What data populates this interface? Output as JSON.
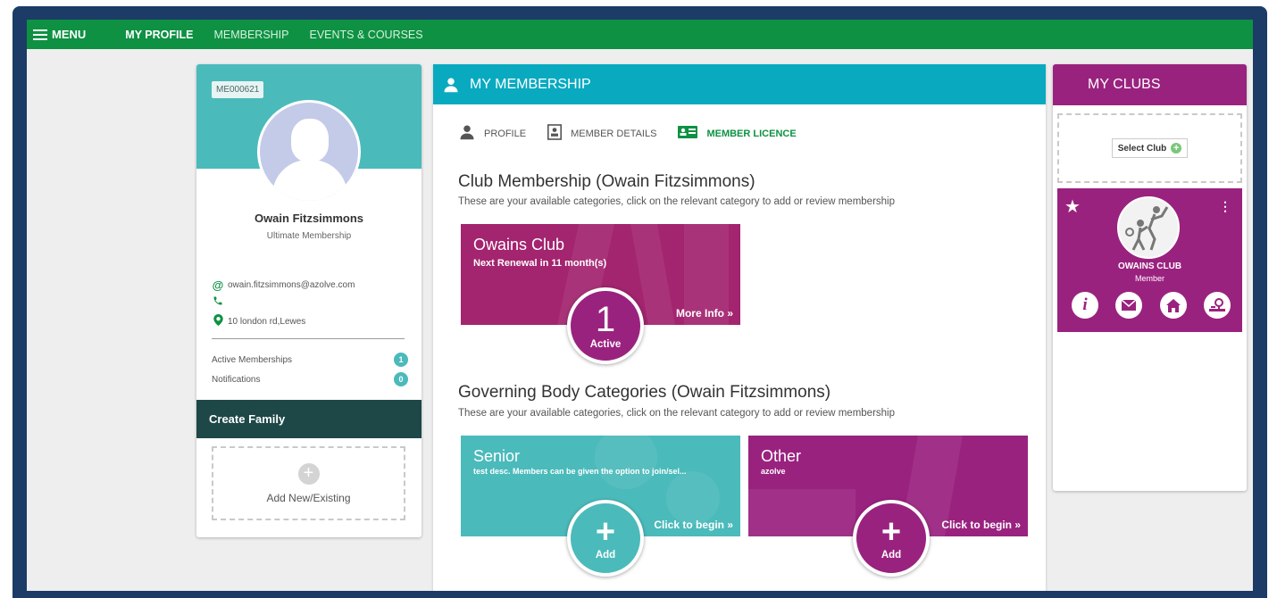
{
  "topbar": {
    "menu_label": "MENU",
    "nav": [
      {
        "label": "MY PROFILE",
        "active": true
      },
      {
        "label": "MEMBERSHIP",
        "active": false
      },
      {
        "label": "EVENTS & COURSES",
        "active": false
      }
    ]
  },
  "profile": {
    "member_id": "ME000621",
    "name": "Owain Fitzsimmons",
    "membership_level": "Ultimate Membership",
    "email": "owain.fitzsimmons@azolve.com",
    "phone": "",
    "address": "10 london rd,Lewes",
    "stats": [
      {
        "label": "Active Memberships",
        "count": "1"
      },
      {
        "label": "Notifications",
        "count": "0"
      }
    ],
    "family": {
      "title": "Create Family",
      "add_label": "Add New/Existing"
    }
  },
  "membership": {
    "title": "MY MEMBERSHIP",
    "tabs": [
      {
        "label": "PROFILE",
        "icon": "user-icon",
        "active": false
      },
      {
        "label": "MEMBER DETAILS",
        "icon": "id-badge-icon",
        "active": false
      },
      {
        "label": "MEMBER LICENCE",
        "icon": "id-card-icon",
        "active": true
      }
    ],
    "club_section": {
      "title": "Club Membership (Owain Fitzsimmons)",
      "subtitle": "These are your available categories, click on the relevant category to add or review membership",
      "tiles": [
        {
          "name": "Owains Club",
          "desc": "Next Renewal in 11 month(s)",
          "link": "More Info »",
          "bubble_number": "1",
          "bubble_label": "Active",
          "color": "#a3246f"
        }
      ]
    },
    "gov_section": {
      "title": "Governing Body Categories (Owain Fitzsimmons)",
      "subtitle": "These are your available categories, click on the relevant category to add or review membership",
      "tiles": [
        {
          "name": "Senior",
          "desc": "test desc. Members can be given the option to join/sel...",
          "link": "Click to begin »",
          "bubble_label": "Add",
          "color": "#4bbabb"
        },
        {
          "name": "Other",
          "desc": "azolve",
          "link": "Click to begin »",
          "bubble_label": "Add",
          "color": "#9a227f"
        }
      ]
    }
  },
  "clubs": {
    "title": "MY CLUBS",
    "select_label": "Select Club",
    "card": {
      "name": "OWAINS CLUB",
      "role": "Member",
      "actions": [
        "info-icon",
        "mail-icon",
        "home-icon",
        "location-icon"
      ]
    }
  },
  "colors": {
    "topbar": "#0e9143",
    "teal": "#4bbabb",
    "cyan_header": "#09aac0",
    "purple": "#9a227f",
    "dark_teal": "#1e4747",
    "frame": "#1c3b66"
  }
}
